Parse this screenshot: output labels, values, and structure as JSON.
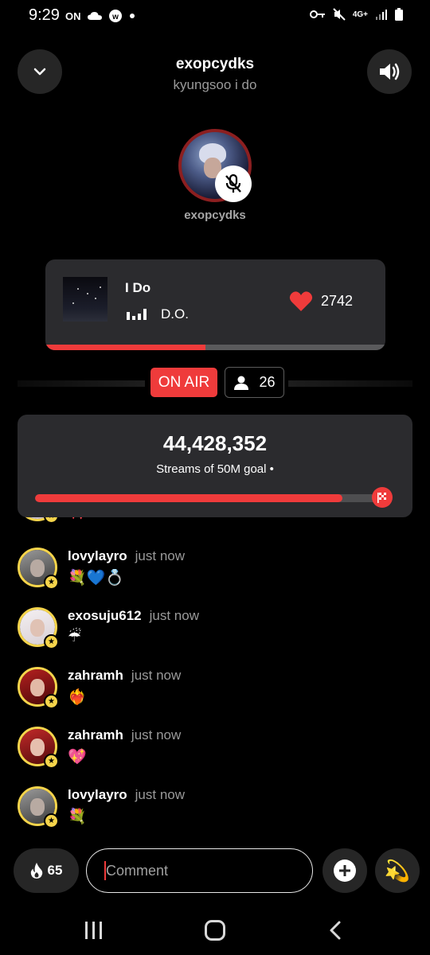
{
  "status_bar": {
    "time": "9:29",
    "on_label": "ON",
    "network": "4G+"
  },
  "header": {
    "title": "exopcydks",
    "subtitle": "kyungsoo i do"
  },
  "host": {
    "name": "exopcydks"
  },
  "now_playing": {
    "title": "I Do",
    "artist": "D.O.",
    "likes": "2742",
    "progress": 0.47
  },
  "live": {
    "on_air_label": "ON AIR",
    "listeners": "26"
  },
  "goal": {
    "streams": "44,428,352",
    "label": "Streams of 50M goal •",
    "progress": 0.8886
  },
  "comments": [
    {
      "user": "",
      "time": "",
      "message": "🎀",
      "avatar_color": "#cfc6d6"
    },
    {
      "user": "lovylayro",
      "time": "just now",
      "message": "💐💙💍",
      "avatar_color": "#6b6b6b"
    },
    {
      "user": "exosuju612",
      "time": "just now",
      "message": "☔",
      "avatar_color": "#e8e2e6"
    },
    {
      "user": "zahramh",
      "time": "just now",
      "message": "❤️‍🔥",
      "avatar_color": "#7a1414"
    },
    {
      "user": "zahramh",
      "time": "just now",
      "message": "💖",
      "avatar_color": "#8a1a1a"
    },
    {
      "user": "lovylayro",
      "time": "just now",
      "message": "💐",
      "avatar_color": "#6b6b6b"
    }
  ],
  "bottom_bar": {
    "fire_count": "65",
    "comment_placeholder": "Comment",
    "sparkle_icon": "💫"
  },
  "colors": {
    "accent": "#ef3b3b",
    "card": "#2b2b2e",
    "badge_gold": "#f5d44b"
  }
}
